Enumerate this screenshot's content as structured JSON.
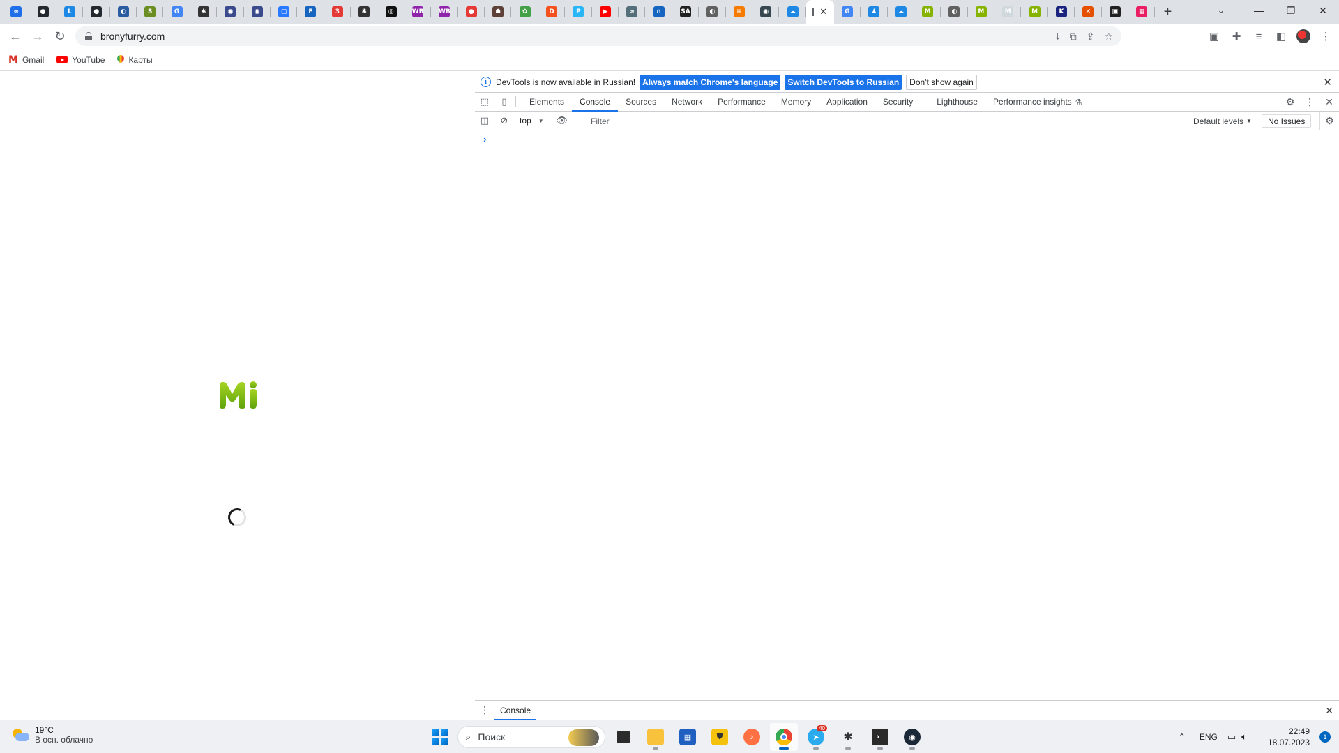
{
  "browser": {
    "tab_icons": [
      {
        "name": "glasses-tab-icon",
        "color": "#1f6feb",
        "glyph": "∞"
      },
      {
        "name": "github-tab-icon",
        "color": "#24292f",
        "glyph": "●"
      },
      {
        "name": "l-tab-icon",
        "color": "#1e88e5",
        "glyph": "L"
      },
      {
        "name": "github-tab-icon",
        "color": "#24292f",
        "glyph": "●"
      },
      {
        "name": "globe-tab-icon",
        "color": "#2a5d9f",
        "glyph": "◐"
      },
      {
        "name": "ring-tab-icon",
        "color": "#6b8e23",
        "glyph": "S"
      },
      {
        "name": "google-tab-icon",
        "color": "#4285f4",
        "glyph": "G"
      },
      {
        "name": "bug-tab-icon",
        "color": "#333333",
        "glyph": "✱"
      },
      {
        "name": "eye-tab-icon",
        "color": "#3b4a8c",
        "glyph": "◉"
      },
      {
        "name": "eye-tab-icon",
        "color": "#3b4a8c",
        "glyph": "◉"
      },
      {
        "name": "chat-tab-icon",
        "color": "#2979ff",
        "glyph": "▢"
      },
      {
        "name": "f-tab-icon",
        "color": "#1565c0",
        "glyph": "F"
      },
      {
        "name": "number-tab-icon",
        "color": "#e53935",
        "glyph": "3"
      },
      {
        "name": "bug-tab-icon",
        "color": "#333333",
        "glyph": "✱"
      },
      {
        "name": "circle-tab-icon",
        "color": "#111111",
        "glyph": "◎"
      },
      {
        "name": "wb-tab-icon",
        "color": "#8e24aa",
        "glyph": "WB"
      },
      {
        "name": "wb-tab-icon",
        "color": "#8e24aa",
        "glyph": "WB"
      },
      {
        "name": "map-pin-tab-icon",
        "color": "#e53935",
        "glyph": "●"
      },
      {
        "name": "person-tab-icon",
        "color": "#5d4037",
        "glyph": "☗"
      },
      {
        "name": "apps-tab-icon",
        "color": "#43a047",
        "glyph": "✿"
      },
      {
        "name": "orange-tab-icon",
        "color": "#f4511e",
        "glyph": "D"
      },
      {
        "name": "p-tab-icon",
        "color": "#29b6f6",
        "glyph": "P"
      },
      {
        "name": "youtube-tab-icon",
        "color": "#ff0000",
        "glyph": "▶"
      },
      {
        "name": "glasses-tab-icon",
        "color": "#546e7a",
        "glyph": "∞"
      },
      {
        "name": "n-tab-icon",
        "color": "#1565c0",
        "glyph": "∩"
      },
      {
        "name": "sa-tab-icon",
        "color": "#212121",
        "glyph": "SA"
      },
      {
        "name": "globe-tab-icon",
        "color": "#616161",
        "glyph": "◐"
      },
      {
        "name": "stack-tab-icon",
        "color": "#f57c00",
        "glyph": "≡"
      },
      {
        "name": "eye-tab-icon",
        "color": "#37474f",
        "glyph": "◉"
      },
      {
        "name": "cloud-tab-icon",
        "color": "#1e88e5",
        "glyph": "☁"
      }
    ],
    "tab_icons_after": [
      {
        "name": "google-tab-icon",
        "color": "#4285f4",
        "glyph": "G"
      },
      {
        "name": "drop-tab-icon",
        "color": "#1e88e5",
        "glyph": "♟"
      },
      {
        "name": "cloud-tab-icon",
        "color": "#1e88e5",
        "glyph": "☁"
      },
      {
        "name": "mi-tab-icon",
        "color": "#86b300",
        "glyph": "M"
      },
      {
        "name": "globe-tab-icon",
        "color": "#616161",
        "glyph": "◐"
      },
      {
        "name": "mi-tab-icon",
        "color": "#86b300",
        "glyph": "M"
      },
      {
        "name": "mi-tab-icon",
        "color": "#cfd8dc",
        "glyph": "M"
      },
      {
        "name": "mi-tab-icon",
        "color": "#86b300",
        "glyph": "M"
      },
      {
        "name": "k-tab-icon",
        "color": "#1a237e",
        "glyph": "K"
      },
      {
        "name": "x-tab-icon",
        "color": "#e65100",
        "glyph": "✕"
      },
      {
        "name": "square-tab-icon",
        "color": "#212121",
        "glyph": "▣"
      },
      {
        "name": "red-square-tab-icon",
        "color": "#e91e63",
        "glyph": "▦"
      }
    ],
    "url": "bronyfurry.com",
    "bookmarks": [
      {
        "label": "Gmail"
      },
      {
        "label": "YouTube"
      },
      {
        "label": "Карты"
      }
    ]
  },
  "devtools": {
    "infobar": {
      "message": "DevTools is now available in Russian!",
      "btn_match": "Always match Chrome's language",
      "btn_switch": "Switch DevTools to Russian",
      "btn_dismiss": "Don't show again"
    },
    "tabs": [
      "Elements",
      "Console",
      "Sources",
      "Network",
      "Performance",
      "Memory",
      "Application",
      "Security",
      "Lighthouse",
      "Performance insights"
    ],
    "selected_tab": "Console",
    "console": {
      "context": "top",
      "filter_placeholder": "Filter",
      "levels": "Default levels",
      "issues": "No Issues",
      "prompt": "›"
    },
    "drawer_tab": "Console",
    "accent": "#1a73e8"
  },
  "taskbar": {
    "weather_temp": "19°C",
    "weather_desc": "В осн. облачно",
    "search_label": "Поиск",
    "lang": "ENG",
    "time": "22:49",
    "date": "18.07.2023",
    "notifications": "1",
    "telegram_badge": "40"
  }
}
